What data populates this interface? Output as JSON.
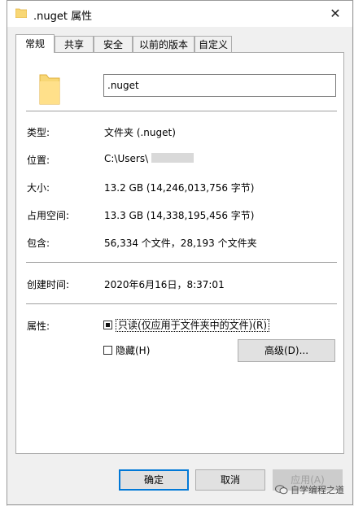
{
  "dialog": {
    "title": ".nuget 属性",
    "close_glyph": "✕"
  },
  "tabs": [
    {
      "label": "常规",
      "active": true
    },
    {
      "label": "共享",
      "active": false
    },
    {
      "label": "安全",
      "active": false
    },
    {
      "label": "以前的版本",
      "active": false
    },
    {
      "label": "自定义",
      "active": false
    }
  ],
  "general": {
    "name_value": ".nuget",
    "rows": [
      {
        "label": "类型:",
        "value": "文件夹 (.nuget)"
      },
      {
        "label": "位置:",
        "value": "C:\\Users\\"
      },
      {
        "label": "大小:",
        "value": "13.2 GB (14,246,013,756 字节)"
      },
      {
        "label": "占用空间:",
        "value": "13.3 GB (14,338,195,456 字节)"
      },
      {
        "label": "包含:",
        "value": "56,334 个文件，28,193 个文件夹"
      },
      {
        "label": "创建时间:",
        "value": "2020年6月16日，8:37:01"
      }
    ],
    "attributes": {
      "label": "属性:",
      "readonly_label": "只读(仅应用于文件夹中的文件)(R)",
      "readonly_state": "indeterminate",
      "hidden_label": "隐藏(H)",
      "hidden_state": "unchecked",
      "advanced_button": "高级(D)..."
    }
  },
  "buttons": {
    "ok": "确定",
    "cancel": "取消",
    "apply": "应用(A)"
  },
  "watermark": "自学编程之道",
  "colors": {
    "accent": "#0078d7",
    "folder": "#f8d775",
    "folder_shade": "#e8b94a"
  },
  "icons": {
    "title": "folder-icon",
    "large": "folder-icon",
    "close": "close-icon"
  }
}
